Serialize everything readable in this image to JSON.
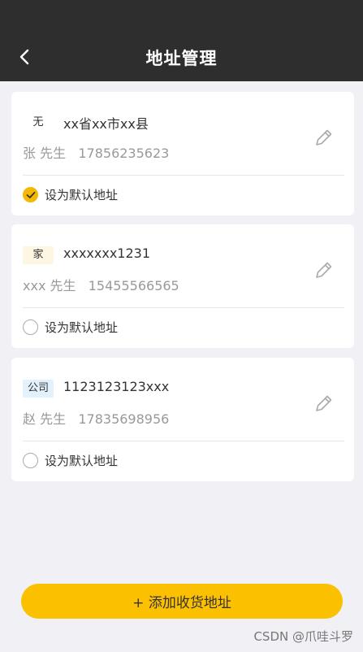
{
  "header": {
    "title": "地址管理",
    "back_icon": "chevron-left-icon"
  },
  "addresses": [
    {
      "tag": "无",
      "address": "xx省xx市xx县",
      "contact": "张 先生   17856235623",
      "default_label": "设为默认地址",
      "is_default": true
    },
    {
      "tag": "家",
      "address": "xxxxxxx1231",
      "contact": "xxx 先生   15455566565",
      "default_label": "设为默认地址",
      "is_default": false
    },
    {
      "tag": "公司",
      "address": "1123123123xxx",
      "contact": "赵 先生   17835698956",
      "default_label": "设为默认地址",
      "is_default": false
    }
  ],
  "footer": {
    "add_button_label": "+ 添加收货地址"
  },
  "watermark": "CSDN @爪哇斗罗",
  "colors": {
    "header_bg": "#2e2e2e",
    "accent": "#fbc000",
    "page_bg": "#f1f1f5"
  }
}
